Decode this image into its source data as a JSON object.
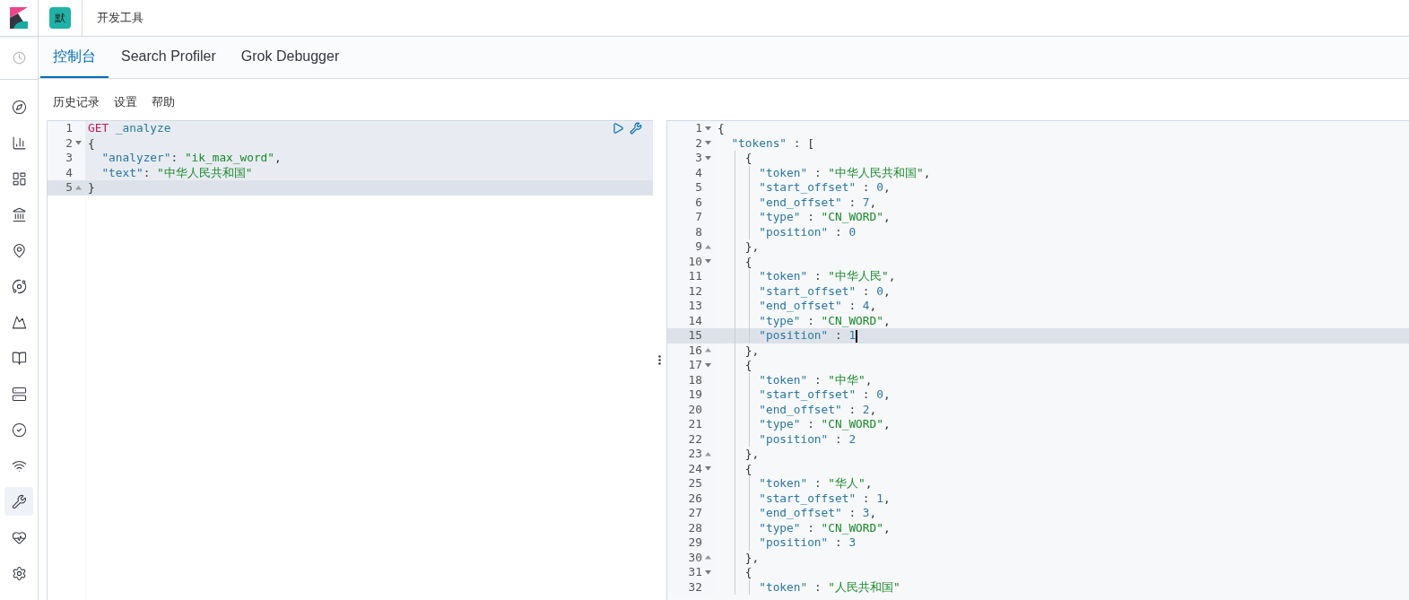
{
  "header": {
    "avatar": "默",
    "breadcrumb": "开发工具"
  },
  "nav_icons": [
    {
      "kind": "compass",
      "selected": false
    },
    {
      "kind": "chart",
      "selected": false
    },
    {
      "kind": "dashboard",
      "selected": false
    },
    {
      "kind": "canvas",
      "selected": false
    },
    {
      "kind": "map",
      "selected": false
    },
    {
      "kind": "ml",
      "selected": false
    },
    {
      "kind": "infra",
      "selected": false
    },
    {
      "kind": "logs",
      "selected": false
    },
    {
      "kind": "apm",
      "selected": false
    },
    {
      "kind": "uptime",
      "selected": false
    },
    {
      "kind": "siem",
      "selected": false
    },
    {
      "kind": "devtools",
      "selected": true
    },
    {
      "kind": "monitoring",
      "selected": false
    },
    {
      "kind": "settings",
      "selected": false
    }
  ],
  "tabs": [
    {
      "label": "控制台",
      "selected": true
    },
    {
      "label": "Search Profiler",
      "selected": false
    },
    {
      "label": "Grok Debugger",
      "selected": false
    }
  ],
  "toolbar": [
    "历史记录",
    "设置",
    "帮助"
  ],
  "request_editor": {
    "lines": [
      {
        "number": "1",
        "kind": "plain",
        "current": false,
        "in_request": true,
        "segments": [
          {
            "kind": "method",
            "text": "GET"
          },
          {
            "kind": "path",
            "text": " _analyze"
          }
        ]
      },
      {
        "number": "2",
        "kind": "opener",
        "current": false,
        "in_request": true,
        "segments": [
          {
            "kind": "punct",
            "text": "{"
          }
        ]
      },
      {
        "number": "3",
        "kind": "plain",
        "current": false,
        "in_request": true,
        "segments": [
          {
            "kind": "key",
            "text": "  \"analyzer\""
          },
          {
            "kind": "punct",
            "text": ": "
          },
          {
            "kind": "string",
            "text": "\"ik_max_word\""
          },
          {
            "kind": "punct",
            "text": ","
          }
        ]
      },
      {
        "number": "4",
        "kind": "plain",
        "current": false,
        "in_request": true,
        "segments": [
          {
            "kind": "key",
            "text": "  \"text\""
          },
          {
            "kind": "punct",
            "text": ": "
          },
          {
            "kind": "string",
            "text": "\"中华人民共和国\""
          }
        ]
      },
      {
        "number": "5",
        "kind": "closer",
        "current": true,
        "in_request": true,
        "segments": [
          {
            "kind": "punct",
            "text": "}"
          }
        ]
      }
    ]
  },
  "response_editor": {
    "lines": [
      {
        "number": "1",
        "kind": "opener",
        "current": false,
        "segments": [
          {
            "kind": "punct",
            "text": "{"
          }
        ]
      },
      {
        "number": "2",
        "kind": "opener",
        "current": false,
        "segments": [
          {
            "kind": "key",
            "text": "  \"tokens\""
          },
          {
            "kind": "punct",
            "text": " : ["
          }
        ]
      },
      {
        "number": "3",
        "kind": "opener",
        "current": false,
        "segments": [
          {
            "kind": "punct",
            "text": "    {"
          }
        ]
      },
      {
        "number": "4",
        "kind": "plain",
        "current": false,
        "segments": [
          {
            "kind": "key",
            "text": "      \"token\""
          },
          {
            "kind": "punct",
            "text": " : "
          },
          {
            "kind": "string",
            "text": "\"中华人民共和国\""
          },
          {
            "kind": "punct",
            "text": ","
          }
        ]
      },
      {
        "number": "5",
        "kind": "plain",
        "current": false,
        "segments": [
          {
            "kind": "key",
            "text": "      \"start_offset\""
          },
          {
            "kind": "punct",
            "text": " : "
          },
          {
            "kind": "number",
            "text": "0"
          },
          {
            "kind": "punct",
            "text": ","
          }
        ]
      },
      {
        "number": "6",
        "kind": "plain",
        "current": false,
        "segments": [
          {
            "kind": "key",
            "text": "      \"end_offset\""
          },
          {
            "kind": "punct",
            "text": " : "
          },
          {
            "kind": "number",
            "text": "7"
          },
          {
            "kind": "punct",
            "text": ","
          }
        ]
      },
      {
        "number": "7",
        "kind": "plain",
        "current": false,
        "segments": [
          {
            "kind": "key",
            "text": "      \"type\""
          },
          {
            "kind": "punct",
            "text": " : "
          },
          {
            "kind": "string",
            "text": "\"CN_WORD\""
          },
          {
            "kind": "punct",
            "text": ","
          }
        ]
      },
      {
        "number": "8",
        "kind": "plain",
        "current": false,
        "segments": [
          {
            "kind": "key",
            "text": "      \"position\""
          },
          {
            "kind": "punct",
            "text": " : "
          },
          {
            "kind": "number",
            "text": "0"
          }
        ]
      },
      {
        "number": "9",
        "kind": "closer",
        "current": false,
        "segments": [
          {
            "kind": "punct",
            "text": "    },"
          }
        ]
      },
      {
        "number": "10",
        "kind": "opener",
        "current": false,
        "segments": [
          {
            "kind": "punct",
            "text": "    {"
          }
        ]
      },
      {
        "number": "11",
        "kind": "plain",
        "current": false,
        "segments": [
          {
            "kind": "key",
            "text": "      \"token\""
          },
          {
            "kind": "punct",
            "text": " : "
          },
          {
            "kind": "string",
            "text": "\"中华人民\""
          },
          {
            "kind": "punct",
            "text": ","
          }
        ]
      },
      {
        "number": "12",
        "kind": "plain",
        "current": false,
        "segments": [
          {
            "kind": "key",
            "text": "      \"start_offset\""
          },
          {
            "kind": "punct",
            "text": " : "
          },
          {
            "kind": "number",
            "text": "0"
          },
          {
            "kind": "punct",
            "text": ","
          }
        ]
      },
      {
        "number": "13",
        "kind": "plain",
        "current": false,
        "segments": [
          {
            "kind": "key",
            "text": "      \"end_offset\""
          },
          {
            "kind": "punct",
            "text": " : "
          },
          {
            "kind": "number",
            "text": "4"
          },
          {
            "kind": "punct",
            "text": ","
          }
        ]
      },
      {
        "number": "14",
        "kind": "plain",
        "current": false,
        "segments": [
          {
            "kind": "key",
            "text": "      \"type\""
          },
          {
            "kind": "punct",
            "text": " : "
          },
          {
            "kind": "string",
            "text": "\"CN_WORD\""
          },
          {
            "kind": "punct",
            "text": ","
          }
        ]
      },
      {
        "number": "15",
        "kind": "plain",
        "current": true,
        "segments": [
          {
            "kind": "key",
            "text": "      \"position\""
          },
          {
            "kind": "punct",
            "text": " : "
          },
          {
            "kind": "number",
            "text": "1"
          }
        ]
      },
      {
        "number": "16",
        "kind": "closer",
        "current": false,
        "segments": [
          {
            "kind": "punct",
            "text": "    },"
          }
        ]
      },
      {
        "number": "17",
        "kind": "opener",
        "current": false,
        "segments": [
          {
            "kind": "punct",
            "text": "    {"
          }
        ]
      },
      {
        "number": "18",
        "kind": "plain",
        "current": false,
        "segments": [
          {
            "kind": "key",
            "text": "      \"token\""
          },
          {
            "kind": "punct",
            "text": " : "
          },
          {
            "kind": "string",
            "text": "\"中华\""
          },
          {
            "kind": "punct",
            "text": ","
          }
        ]
      },
      {
        "number": "19",
        "kind": "plain",
        "current": false,
        "segments": [
          {
            "kind": "key",
            "text": "      \"start_offset\""
          },
          {
            "kind": "punct",
            "text": " : "
          },
          {
            "kind": "number",
            "text": "0"
          },
          {
            "kind": "punct",
            "text": ","
          }
        ]
      },
      {
        "number": "20",
        "kind": "plain",
        "current": false,
        "segments": [
          {
            "kind": "key",
            "text": "      \"end_offset\""
          },
          {
            "kind": "punct",
            "text": " : "
          },
          {
            "kind": "number",
            "text": "2"
          },
          {
            "kind": "punct",
            "text": ","
          }
        ]
      },
      {
        "number": "21",
        "kind": "plain",
        "current": false,
        "segments": [
          {
            "kind": "key",
            "text": "      \"type\""
          },
          {
            "kind": "punct",
            "text": " : "
          },
          {
            "kind": "string",
            "text": "\"CN_WORD\""
          },
          {
            "kind": "punct",
            "text": ","
          }
        ]
      },
      {
        "number": "22",
        "kind": "plain",
        "current": false,
        "segments": [
          {
            "kind": "key",
            "text": "      \"position\""
          },
          {
            "kind": "punct",
            "text": " : "
          },
          {
            "kind": "number",
            "text": "2"
          }
        ]
      },
      {
        "number": "23",
        "kind": "closer",
        "current": false,
        "segments": [
          {
            "kind": "punct",
            "text": "    },"
          }
        ]
      },
      {
        "number": "24",
        "kind": "opener",
        "current": false,
        "segments": [
          {
            "kind": "punct",
            "text": "    {"
          }
        ]
      },
      {
        "number": "25",
        "kind": "plain",
        "current": false,
        "segments": [
          {
            "kind": "key",
            "text": "      \"token\""
          },
          {
            "kind": "punct",
            "text": " : "
          },
          {
            "kind": "string",
            "text": "\"华人\""
          },
          {
            "kind": "punct",
            "text": ","
          }
        ]
      },
      {
        "number": "26",
        "kind": "plain",
        "current": false,
        "segments": [
          {
            "kind": "key",
            "text": "      \"start_offset\""
          },
          {
            "kind": "punct",
            "text": " : "
          },
          {
            "kind": "number",
            "text": "1"
          },
          {
            "kind": "punct",
            "text": ","
          }
        ]
      },
      {
        "number": "27",
        "kind": "plain",
        "current": false,
        "segments": [
          {
            "kind": "key",
            "text": "      \"end_offset\""
          },
          {
            "kind": "punct",
            "text": " : "
          },
          {
            "kind": "number",
            "text": "3"
          },
          {
            "kind": "punct",
            "text": ","
          }
        ]
      },
      {
        "number": "28",
        "kind": "plain",
        "current": false,
        "segments": [
          {
            "kind": "key",
            "text": "      \"type\""
          },
          {
            "kind": "punct",
            "text": " : "
          },
          {
            "kind": "string",
            "text": "\"CN_WORD\""
          },
          {
            "kind": "punct",
            "text": ","
          }
        ]
      },
      {
        "number": "29",
        "kind": "plain",
        "current": false,
        "segments": [
          {
            "kind": "key",
            "text": "      \"position\""
          },
          {
            "kind": "punct",
            "text": " : "
          },
          {
            "kind": "number",
            "text": "3"
          }
        ]
      },
      {
        "number": "30",
        "kind": "closer",
        "current": false,
        "segments": [
          {
            "kind": "punct",
            "text": "    },"
          }
        ]
      },
      {
        "number": "31",
        "kind": "opener",
        "current": false,
        "segments": [
          {
            "kind": "punct",
            "text": "    {"
          }
        ]
      },
      {
        "number": "32",
        "kind": "plain",
        "current": false,
        "segments": [
          {
            "kind": "key",
            "text": "      \"token\""
          },
          {
            "kind": "punct",
            "text": " : "
          },
          {
            "kind": "string",
            "text": "\"人民共和国\""
          }
        ]
      }
    ]
  }
}
